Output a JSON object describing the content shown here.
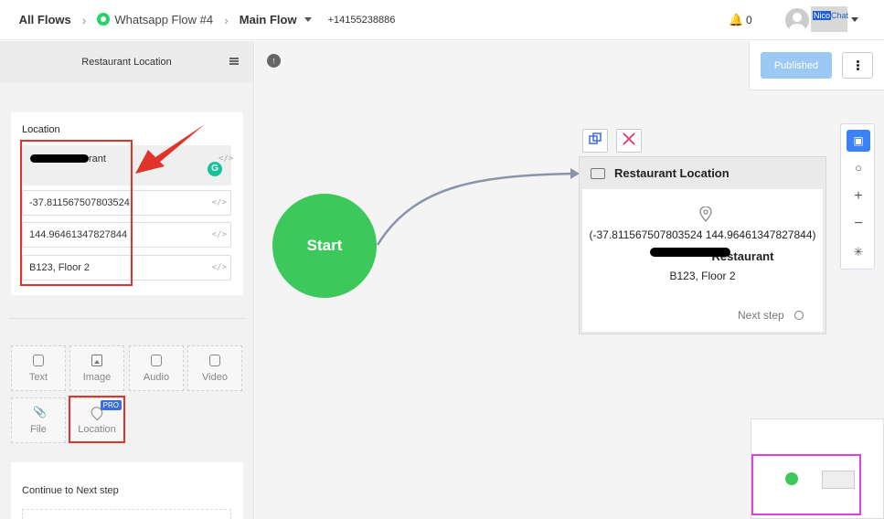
{
  "breadcrumb": {
    "all_flows": "All Flows",
    "flow_name": "Whatsapp Flow #4",
    "subflow": "Main Flow",
    "phone": "+14155238886"
  },
  "header": {
    "notification_count": "0",
    "brand_nico": "Nico",
    "brand_chat": "Chat"
  },
  "left_panel": {
    "title": "Restaurant Location",
    "section_label": "Location",
    "name_suffix": "rant",
    "latitude": "-37.811567507803524",
    "longitude": "144.96461347827844",
    "address": "B123, Floor 2",
    "code_icon": "</>",
    "tiles": [
      {
        "label": "Text",
        "icon": "file-text-icon"
      },
      {
        "label": "Image",
        "icon": "image-icon"
      },
      {
        "label": "Audio",
        "icon": "audio-icon"
      },
      {
        "label": "Video",
        "icon": "video-icon"
      },
      {
        "label": "File",
        "icon": "paperclip-icon"
      },
      {
        "label": "Location",
        "icon": "map-pin-icon",
        "badge": "PRO"
      }
    ],
    "continue_label": "Continue to Next step"
  },
  "toolbar": {
    "publish_label": "Published"
  },
  "canvas": {
    "start_label": "Start",
    "node": {
      "title": "Restaurant Location",
      "coords": "(-37.811567507803524 144.96461347827844)",
      "name_suffix": "Restaurant",
      "address": "B123, Floor 2",
      "next_step": "Next step"
    }
  },
  "colors": {
    "start_green": "#3cc85a",
    "accent_blue": "#3b82f6",
    "publish_blue": "#9cc9f3",
    "annotation_red": "#e0342a",
    "minimap_magenta": "#e040e0"
  }
}
